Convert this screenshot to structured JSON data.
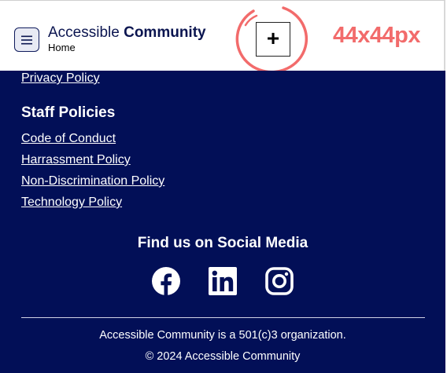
{
  "header": {
    "brand_light": "Accessible ",
    "brand_bold": "Community",
    "subtitle": "Home",
    "plus_label": "+",
    "annotation": "44x44px"
  },
  "footer": {
    "top_link": "Privacy Policy",
    "staff_heading": "Staff Policies",
    "staff_links": [
      "Code of Conduct",
      "Harrassment Policy",
      "Non-Discrimination Policy",
      "Technology Policy"
    ],
    "social_heading": "Find us on Social Media",
    "social_icons": [
      "facebook-icon",
      "linkedin-icon",
      "instagram-icon"
    ],
    "org_line": "Accessible Community is a 501(c)3 organization.",
    "copyright": "© 2024 Accessible Community"
  },
  "colors": {
    "navy": "#020f57",
    "annotation": "#f26b6b"
  }
}
